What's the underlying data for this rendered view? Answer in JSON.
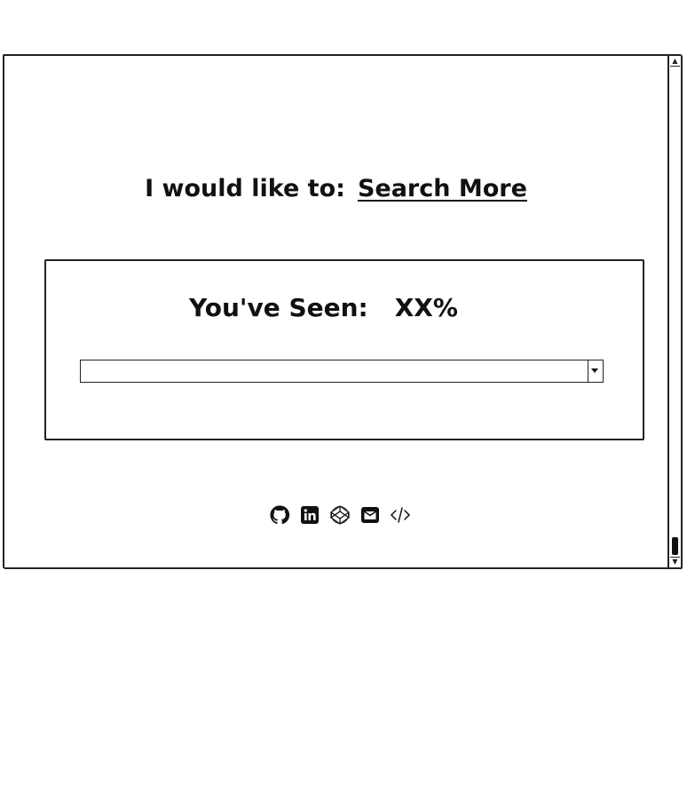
{
  "header": {
    "lead": "I would like to:",
    "action_link": "Search More"
  },
  "progress": {
    "label": "You've Seen:",
    "value": "XX%"
  },
  "dropdown": {
    "selected": ""
  },
  "footer": {
    "icons": [
      "github-icon",
      "linkedin-icon",
      "codepen-icon",
      "email-icon",
      "code-icon"
    ]
  }
}
